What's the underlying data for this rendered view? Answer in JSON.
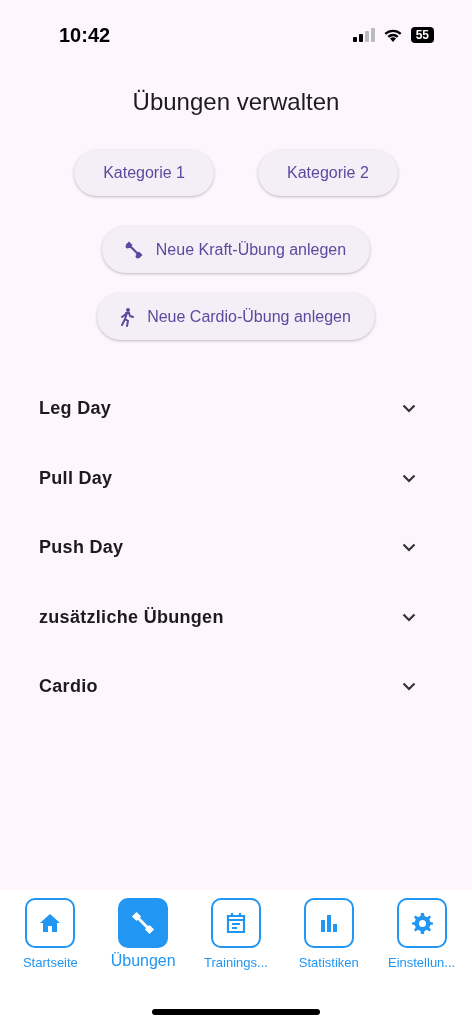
{
  "status_bar": {
    "time": "10:42",
    "battery": "55"
  },
  "title": "Übungen verwalten",
  "category_buttons": [
    "Kategorie 1",
    "Kategorie 2"
  ],
  "action_buttons": [
    {
      "kind": "strength",
      "label": "Neue Kraft-Übung anlegen"
    },
    {
      "kind": "cardio",
      "label": "Neue Cardio-Übung anlegen"
    }
  ],
  "sections": [
    {
      "label": "Leg Day",
      "expanded": false
    },
    {
      "label": "Pull Day",
      "expanded": false
    },
    {
      "label": "Push Day",
      "expanded": false
    },
    {
      "label": "zusätzliche Übungen",
      "expanded": false
    },
    {
      "label": "Cardio",
      "expanded": false
    }
  ],
  "nav": [
    {
      "kind": "home",
      "label": "Startseite",
      "selected": false
    },
    {
      "kind": "dumbbell",
      "label": "Übungen",
      "selected": true
    },
    {
      "kind": "calendar",
      "label": "Trainings...",
      "selected": false
    },
    {
      "kind": "chart",
      "label": "Statistiken",
      "selected": false
    },
    {
      "kind": "gear",
      "label": "Einstellun...",
      "selected": false
    }
  ]
}
